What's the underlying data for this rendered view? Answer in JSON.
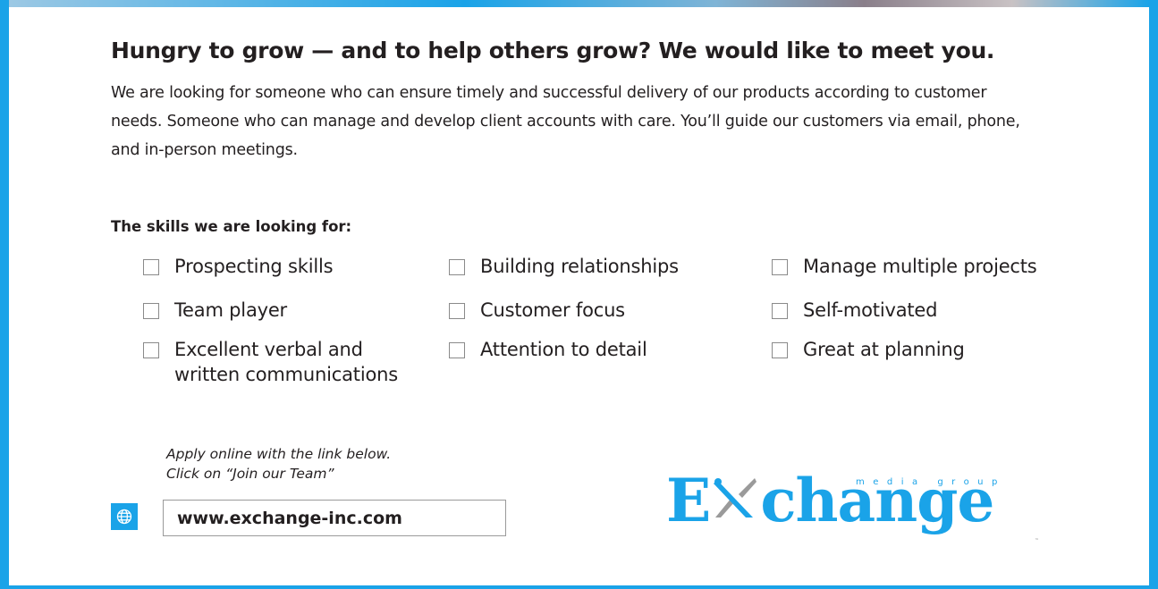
{
  "headline": "Hungry to grow — and to help others grow? We would like to meet you.",
  "intro": "We are looking for someone who can ensure timely and successful delivery of our products according to customer needs. Someone who can manage and develop client accounts with care. You’ll guide our customers via email, phone, and in-person meetings.",
  "skills_heading": "The skills we are looking for:",
  "skills": [
    {
      "label": "Prospecting skills",
      "checked": false
    },
    {
      "label": "Building relationships",
      "checked": false
    },
    {
      "label": "Manage multiple projects",
      "checked": false
    },
    {
      "label": "Team player",
      "checked": false
    },
    {
      "label": "Customer focus",
      "checked": false
    },
    {
      "label": "Self-motivated",
      "checked": false
    },
    {
      "label": "Excellent verbal and",
      "label_line2": "written communications",
      "checked": false
    },
    {
      "label": "Attention to detail",
      "checked": false
    },
    {
      "label": "Great at planning",
      "checked": false
    }
  ],
  "apply": {
    "line1": "Apply online with the link below.",
    "line2": "Click on “Join our Team”",
    "url": "www.exchange-inc.com",
    "icon": "globe-icon"
  },
  "logo": {
    "letter_e": "E",
    "rest": "change",
    "tagline": "media group",
    "trademark": "™"
  },
  "colors": {
    "accent": "#1aa3e8",
    "text": "#231f20",
    "border": "#9a9a9a"
  }
}
